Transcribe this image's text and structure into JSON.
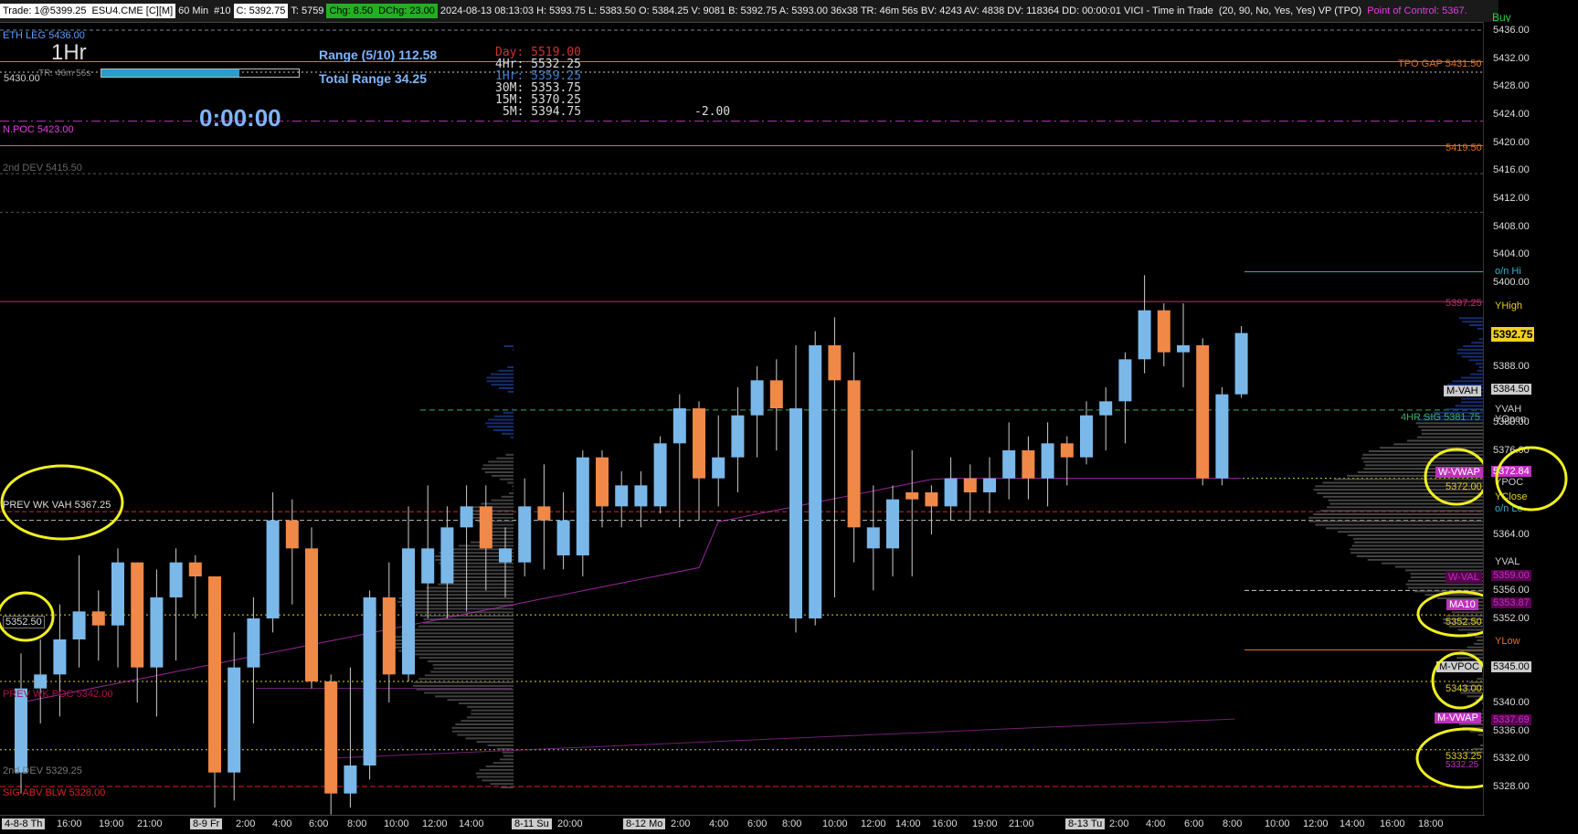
{
  "header": {
    "trade": "Trade: 1@5399.25",
    "symbol": "ESU4.CME [C][M]",
    "interval": "60 Min",
    "number": "#10",
    "close": "C: 5392.75",
    "total": "T: 5759",
    "chg": "Chg: 8.50",
    "dchg": "DChg: 23.00",
    "stats": "2024-08-13 08:13:03 H: 5393.75 L: 5383.50 O: 5384.25 V: 9081 B: 5392.75 A: 5393.00 36x38 TR: 46m 56s BV: 4243 AV: 4838 DV: 118364 DD: 00:00:01 VICI - Time in Trade",
    "params": "(20, 90, No, Yes, Yes)  VP (TPO)",
    "poc": "Point of Control: 5367.",
    "buy": "Buy"
  },
  "overlay": {
    "eth_leg": "ETH LEG  5436.00",
    "timeframe": "1Hr",
    "tr": "TR: 46m 56s",
    "range": "Range (5/10) 112.58",
    "total_range": "Total Range 34.25",
    "timer": "0:00:00",
    "prior": "5430.00",
    "day": "Day:  5519.00",
    "h4": "4Hr:  5532.25",
    "h1": "1Hr:  5359.25",
    "m30": "30M:  5353.75",
    "m15": "15M:  5370.25",
    "m5": "5M:  5394.75",
    "delta": "-2.00",
    "npoc": "N.POC  5423.00",
    "dev2_top": "2nd DEV  5415.50",
    "prev_wk_vah": "PREV WK VAH  5367.25",
    "left_5352": "5352.50",
    "prev_wk_poc": "PREV WK POC  5342.00",
    "dev2_bot": "2nd DEV  5329.25",
    "sig_abv_blw": "SIG ABV BLW  5328.00",
    "tpo_gap": "TPO GAP  5431.50",
    "r5419": "5419.50",
    "r5397": "5397.25",
    "m_vah": "M-VAH",
    "sig4": "4HR SIG  5381.75",
    "w_vwap": "W-VWAP",
    "r5372": "5372.00",
    "w_val": "W-VAL",
    "ma": "MA10",
    "r5352": "5352.50",
    "m_vpoc": "M-VPOC",
    "r5343": "5343.00",
    "m_vwap": "M-VWAP",
    "r5333": "5333.25",
    "r5333b": "5332.25",
    "marker": "36"
  },
  "axis_right": {
    "ticks": [
      "5436.00",
      "5432.00",
      "5428.00",
      "5424.00",
      "5420.00",
      "5416.00",
      "5412.00",
      "5408.00",
      "5404.00",
      "5400.00",
      "5388.00",
      "5380.00",
      "5376.00",
      "5364.00",
      "5356.00",
      "5352.00",
      "5340.00",
      "5336.00",
      "5332.00",
      "5328.00"
    ],
    "labels": {
      "on_hi": "o/n Hi",
      "yhigh": "YHigh",
      "last": "5392.75",
      "p5384": "5384.50",
      "vwah": "YVAH",
      "yopen": "YOpen",
      "p5372": "5372.84",
      "ypoc": "YPOC",
      "yclose": "YClose",
      "on_lo": "o/n Lo",
      "yval": "YVAL",
      "p5359": "5359.00",
      "p5353": "5353.87",
      "ylow": "YLow",
      "p5345": "5345.00",
      "p5337": "5337.69"
    }
  },
  "axis_bottom": [
    "4-8-8 Th",
    "16:00",
    "19:00",
    "21:00",
    "8-9 Fr",
    "2:00",
    "4:00",
    "6:00",
    "8:00",
    "10:00",
    "12:00",
    "14:00",
    "8-11 Su",
    "20:00",
    "8-12 Mo",
    "2:00",
    "4:00",
    "6:00",
    "8:00",
    "10:00",
    "12:00",
    "14:00",
    "16:00",
    "19:00",
    "21:00",
    "8-13 Tu",
    "2:00",
    "4:00",
    "6:00",
    "8:00",
    "10:00",
    "12:00",
    "14:00",
    "16:00",
    "18:00"
  ],
  "candles": [
    [
      5330,
      5342,
      5327,
      5347,
      "u"
    ],
    [
      5342,
      5344,
      5337,
      5349,
      "u"
    ],
    [
      5344,
      5349,
      5338,
      5354,
      "u"
    ],
    [
      5349,
      5353,
      5345,
      5361,
      "u"
    ],
    [
      5353,
      5351,
      5346,
      5356,
      "d"
    ],
    [
      5351,
      5360,
      5345,
      5362,
      "u"
    ],
    [
      5360,
      5345,
      5340,
      5360,
      "d"
    ],
    [
      5345,
      5355,
      5338,
      5359,
      "u"
    ],
    [
      5355,
      5360,
      5346,
      5362,
      "u"
    ],
    [
      5360,
      5358,
      5352,
      5361,
      "d"
    ],
    [
      5358,
      5330,
      5325,
      5358,
      "d"
    ],
    [
      5330,
      5345,
      5326,
      5350,
      "u"
    ],
    [
      5345,
      5352,
      5337,
      5355,
      "u"
    ],
    [
      5352,
      5366,
      5350,
      5370,
      "u"
    ],
    [
      5366,
      5362,
      5354,
      5369,
      "d"
    ],
    [
      5362,
      5343,
      5342,
      5365,
      "d"
    ],
    [
      5343,
      5327,
      5324,
      5344,
      "d"
    ],
    [
      5327,
      5331,
      5325,
      5345,
      "u"
    ],
    [
      5331,
      5355,
      5329,
      5356,
      "u"
    ],
    [
      5355,
      5344,
      5340,
      5360,
      "d"
    ],
    [
      5344,
      5362,
      5343,
      5368,
      "u"
    ],
    [
      5362,
      5357,
      5352,
      5371,
      "u"
    ],
    [
      5357,
      5365,
      5352,
      5368,
      "u"
    ],
    [
      5365,
      5368,
      5353,
      5371,
      "u"
    ],
    [
      5368,
      5362,
      5356,
      5371,
      "d"
    ],
    [
      5362,
      5360,
      5355,
      5365,
      "u"
    ],
    [
      5360,
      5368,
      5358,
      5372,
      "u"
    ],
    [
      5368,
      5366,
      5359,
      5374,
      "d"
    ],
    [
      5366,
      5361,
      5359,
      5370,
      "u"
    ],
    [
      5361,
      5375,
      5358,
      5376,
      "u"
    ],
    [
      5375,
      5368,
      5365,
      5376,
      "d"
    ],
    [
      5368,
      5371,
      5365,
      5373,
      "u"
    ],
    [
      5371,
      5368,
      5365,
      5373,
      "u"
    ],
    [
      5368,
      5377,
      5367,
      5378,
      "u"
    ],
    [
      5377,
      5382,
      5365,
      5384,
      "u"
    ],
    [
      5382,
      5372,
      5366,
      5383,
      "d"
    ],
    [
      5372,
      5375,
      5368,
      5381,
      "u"
    ],
    [
      5375,
      5381,
      5370,
      5385,
      "u"
    ],
    [
      5381,
      5386,
      5375,
      5388,
      "u"
    ],
    [
      5386,
      5382,
      5376,
      5389,
      "d"
    ],
    [
      5382,
      5352,
      5350,
      5391,
      "u"
    ],
    [
      5352,
      5391,
      5351,
      5393,
      "u"
    ],
    [
      5391,
      5386,
      5355,
      5395,
      "d"
    ],
    [
      5386,
      5365,
      5360,
      5390,
      "d"
    ],
    [
      5365,
      5362,
      5356,
      5371,
      "u"
    ],
    [
      5362,
      5369,
      5358,
      5371,
      "u"
    ],
    [
      5369,
      5370,
      5358,
      5376,
      "d"
    ],
    [
      5370,
      5368,
      5364,
      5371,
      "d"
    ],
    [
      5368,
      5372,
      5366,
      5375,
      "u"
    ],
    [
      5372,
      5370,
      5366,
      5374,
      "d"
    ],
    [
      5370,
      5372,
      5367,
      5375,
      "u"
    ],
    [
      5372,
      5376,
      5369,
      5380,
      "u"
    ],
    [
      5376,
      5372,
      5369,
      5378,
      "d"
    ],
    [
      5372,
      5377,
      5368,
      5380,
      "u"
    ],
    [
      5377,
      5375,
      5371,
      5378,
      "d"
    ],
    [
      5375,
      5381,
      5374,
      5383,
      "u"
    ],
    [
      5381,
      5383,
      5376,
      5385,
      "u"
    ],
    [
      5383,
      5389,
      5377,
      5390,
      "u"
    ],
    [
      5389,
      5396,
      5387,
      5401,
      "u"
    ],
    [
      5396,
      5390,
      5388,
      5397,
      "d"
    ],
    [
      5390,
      5391,
      5385,
      5397,
      "u"
    ],
    [
      5391,
      5372,
      5371,
      5392,
      "d"
    ],
    [
      5372,
      5384,
      5371,
      5385,
      "u"
    ],
    [
      5384,
      5392.75,
      5383.5,
      5393.75,
      "u"
    ]
  ]
}
